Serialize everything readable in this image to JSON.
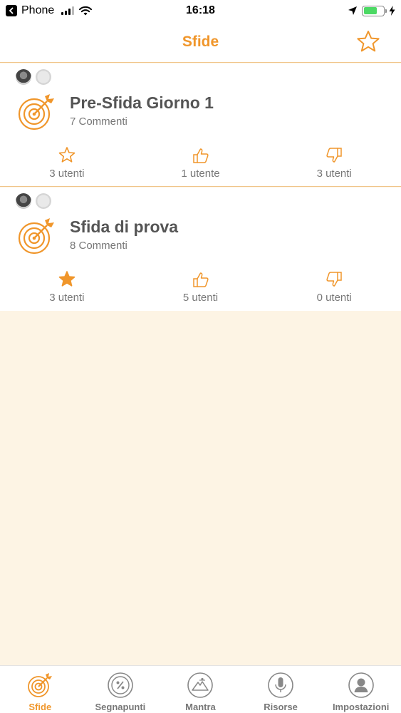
{
  "status_bar": {
    "carrier": "Phone",
    "time": "16:18",
    "battery_level": 0.7
  },
  "header": {
    "title": "Sfide"
  },
  "challenges": [
    {
      "title": "Pre-Sfida Giorno 1",
      "comments": "7 Commenti",
      "favorite_label": "3 utenti",
      "like_label": "1 utente",
      "dislike_label": "3 utenti",
      "favorited": false
    },
    {
      "title": "Sfida di prova",
      "comments": "8 Commenti",
      "favorite_label": "3 utenti",
      "like_label": "5 utenti",
      "dislike_label": "0 utenti",
      "favorited": true
    }
  ],
  "tab_bar": {
    "items": [
      {
        "label": "Sfide",
        "icon": "target-icon"
      },
      {
        "label": "Segnapunti",
        "icon": "score-icon"
      },
      {
        "label": "Mantra",
        "icon": "mountain-icon"
      },
      {
        "label": "Risorse",
        "icon": "microphone-icon"
      },
      {
        "label": "Impostazioni",
        "icon": "person-icon"
      }
    ],
    "active": "Sfide"
  },
  "colors": {
    "accent": "#f0962b",
    "background": "#fdf4e4",
    "divider": "#f0c58a"
  }
}
